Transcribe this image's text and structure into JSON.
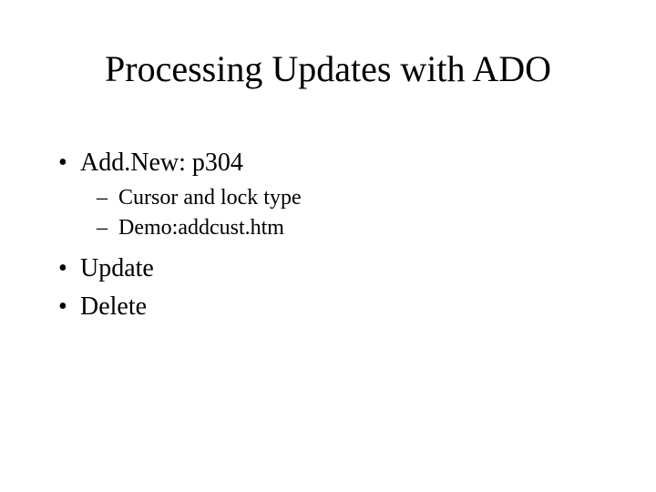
{
  "title": "Processing Updates with ADO",
  "bullets": {
    "b1": "Add.New: p304",
    "b1_sub1": "Cursor and lock type",
    "b1_sub2": "Demo:addcust.htm",
    "b2": "Update",
    "b3": "Delete"
  }
}
